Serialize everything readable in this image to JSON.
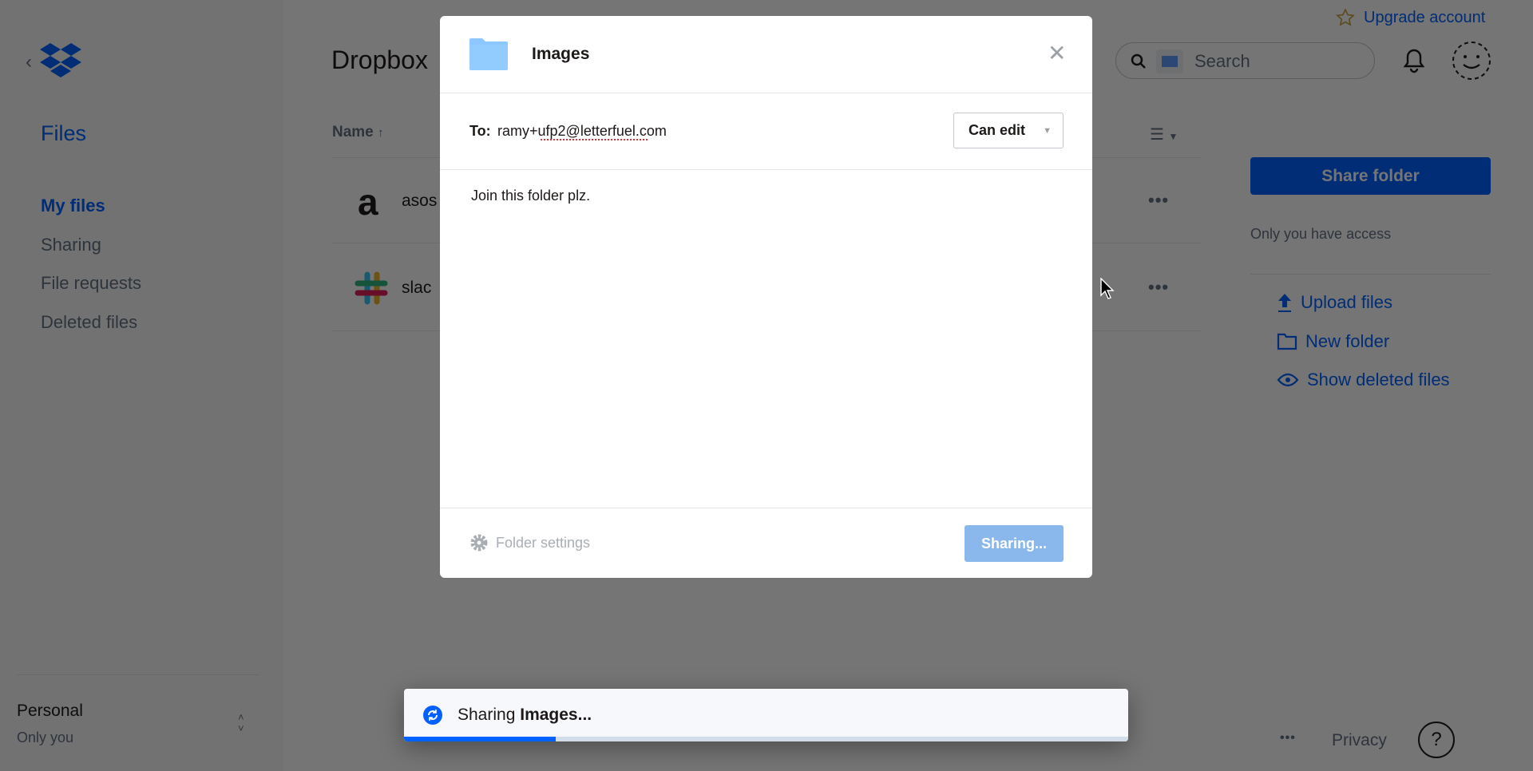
{
  "sidebar": {
    "section_title": "Files",
    "items": [
      {
        "label": "My files",
        "active": true
      },
      {
        "label": "Sharing"
      },
      {
        "label": "File requests"
      },
      {
        "label": "Deleted files"
      }
    ],
    "account": {
      "name": "Personal",
      "subtitle": "Only you"
    }
  },
  "header": {
    "title": "Dropbox",
    "upgrade_label": "Upgrade account",
    "search_placeholder": "Search"
  },
  "file_list": {
    "sort_column": "Name",
    "sort_direction": "ascending",
    "rows": [
      {
        "name": "asos"
      },
      {
        "name": "slac"
      }
    ]
  },
  "right_panel": {
    "share_button": "Share folder",
    "access_text": "Only you have access",
    "actions": [
      {
        "label": "Upload files",
        "icon": "upload-icon"
      },
      {
        "label": "New folder",
        "icon": "folder-icon"
      },
      {
        "label": "Show deleted files",
        "icon": "eye-icon"
      }
    ]
  },
  "footer": {
    "more": "•••",
    "privacy": "Privacy",
    "help": "?"
  },
  "modal": {
    "title": "Images",
    "to_label": "To:",
    "to_value": "ramy+ufp2@letterfuel.com",
    "permission": "Can edit",
    "message": "Join this folder plz.",
    "settings_label": "Folder settings",
    "submit_label": "Sharing..."
  },
  "toast": {
    "prefix": "Sharing",
    "item": "Images",
    "suffix": "...",
    "progress_percent": 21
  },
  "colors": {
    "accent": "#0061fe",
    "folder": "#8cc8ff",
    "sharing_button": "#8ab8ec"
  }
}
